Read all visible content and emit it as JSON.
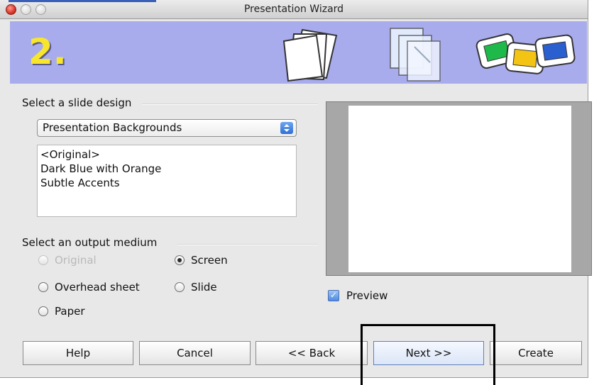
{
  "window": {
    "title": "Presentation Wizard"
  },
  "banner": {
    "step": "2."
  },
  "slide_design": {
    "group_label": "Select a slide design",
    "category_select": "Presentation Backgrounds",
    "items": [
      "<Original>",
      "Dark Blue with Orange",
      "Subtle Accents"
    ]
  },
  "output_medium": {
    "group_label": "Select an output medium",
    "options": [
      {
        "label": "Original",
        "state": "disabled"
      },
      {
        "label": "Screen",
        "state": "selected"
      },
      {
        "label": "Overhead sheet",
        "state": "unselected"
      },
      {
        "label": "Slide",
        "state": "unselected"
      },
      {
        "label": "Paper",
        "state": "unselected"
      }
    ]
  },
  "preview": {
    "checkbox_label": "Preview",
    "checked": true
  },
  "buttons": {
    "help": "Help",
    "cancel": "Cancel",
    "back": "<< Back",
    "next": "Next >>",
    "create": "Create"
  },
  "colors": {
    "banner_bg": "#a8acec",
    "step_number": "#f7e52e",
    "accent_blue": "#3a5fb8"
  }
}
